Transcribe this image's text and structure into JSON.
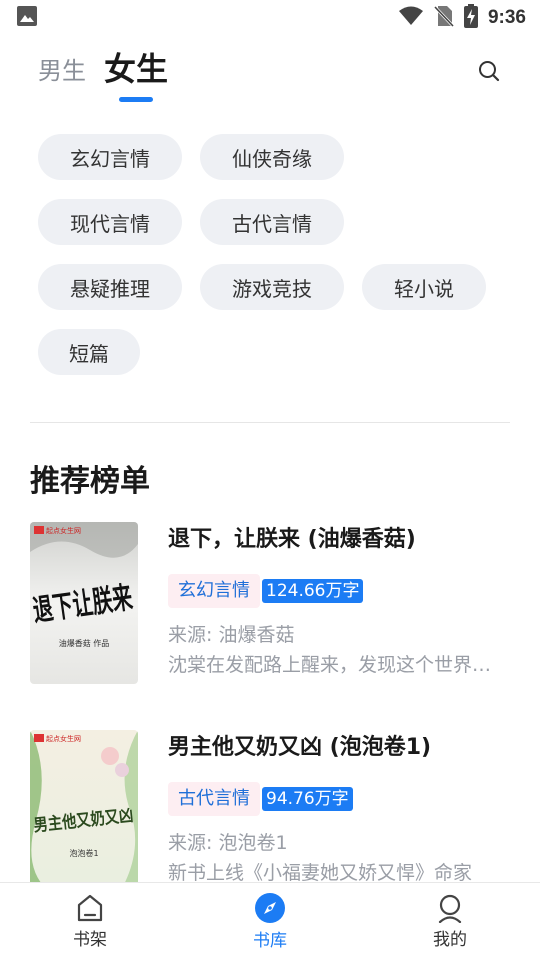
{
  "status": {
    "time": "9:36"
  },
  "gender_tabs": {
    "male": "男生",
    "female": "女生",
    "selected": "female"
  },
  "categories": [
    "玄幻言情",
    "仙侠奇缘",
    "现代言情",
    "古代言情",
    "悬疑推理",
    "游戏竞技",
    "轻小说",
    "短篇"
  ],
  "section": {
    "title": "推荐榜单"
  },
  "books": [
    {
      "title": "退下，让朕来 (油爆香菇)",
      "category": "玄幻言情",
      "words": "124.66万字",
      "source": "来源: 油爆香菇",
      "desc": "沈棠在发配路上醒来，发现这个世界的文字人人都能修炼…",
      "cover": {
        "title": "退下让朕来",
        "author": "油爆香菇 作品",
        "publisher": "起点女生网"
      }
    },
    {
      "title": "男主他又奶又凶 (泡泡卷1)",
      "category": "古代言情",
      "words": "94.76万字",
      "source": "来源: 泡泡卷1",
      "desc": "新书上线《小福妻她又娇又悍》命家",
      "cover": {
        "title": "男主他又奶又凶",
        "author": "泡泡卷1",
        "publisher": "起点女生网"
      }
    }
  ],
  "bottom_nav": [
    {
      "label": "书架",
      "icon": "bookshelf-icon"
    },
    {
      "label": "书库",
      "icon": "compass-icon",
      "active": true
    },
    {
      "label": "我的",
      "icon": "profile-icon"
    }
  ],
  "colors": {
    "accent": "#1c7cf4",
    "chip_bg": "#eef0f4",
    "tag_bg": "#fdeef2"
  }
}
